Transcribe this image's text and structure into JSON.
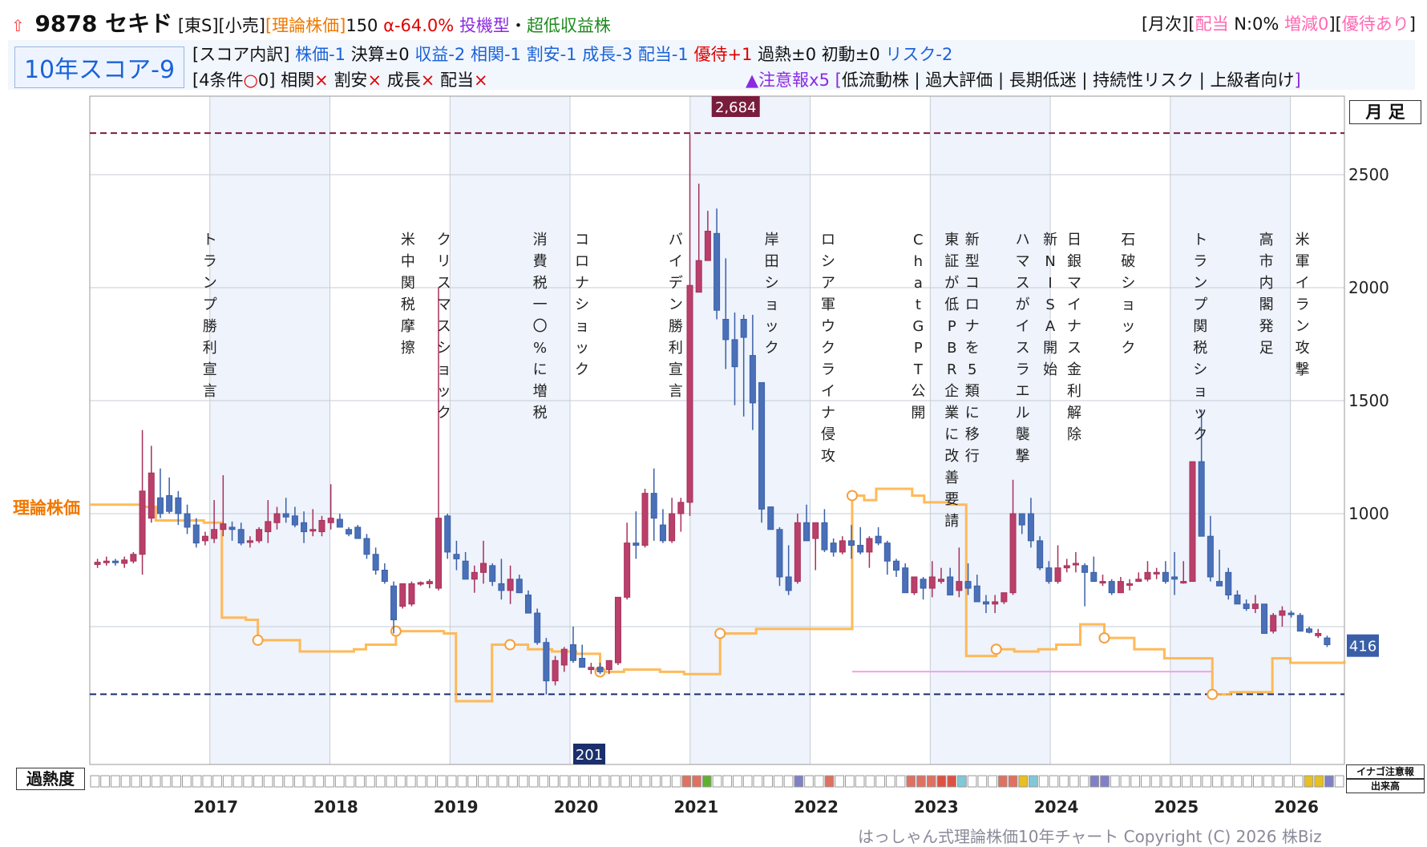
{
  "header": {
    "code_name": "9878 セキド",
    "market": "[東S][小売]",
    "theory_label": "[理論株価]",
    "theory_value": "150",
    "alpha": "α-64.0%",
    "type1": "投機型",
    "sep": "・",
    "type2": "超低収益株",
    "monthly": "[月次][",
    "dividend": "配当",
    "n_text": " N:0% ",
    "change": "増減0",
    "close_br": "][",
    "yutai": "優待あり",
    "end_br": "]"
  },
  "score": {
    "box": "10年スコア-9",
    "line1_prefix": "[スコア内訳]",
    "line1_items": [
      {
        "text": "株価-1",
        "color": "#1a63d8"
      },
      {
        "text": "決算±0",
        "color": "#111111"
      },
      {
        "text": "収益-2",
        "color": "#1a63d8"
      },
      {
        "text": "相関-1",
        "color": "#1a63d8"
      },
      {
        "text": "割安-1",
        "color": "#1a63d8"
      },
      {
        "text": "成長-3",
        "color": "#1a63d8"
      },
      {
        "text": "配当-1",
        "color": "#1a63d8"
      },
      {
        "text": "優待+1",
        "color": "#e00000"
      },
      {
        "text": "過熱±0",
        "color": "#111111"
      },
      {
        "text": "初動±0",
        "color": "#111111"
      },
      {
        "text": "リスク-2",
        "color": "#1a63d8"
      }
    ],
    "line2_prefix": "[4条件",
    "line2_circle": "○",
    "line2_zero": "0]",
    "line2_items": [
      "相関",
      "割安",
      "成長",
      "配当"
    ],
    "cross": "×",
    "warning_label": "▲注意報x5",
    "warning_open": "[",
    "warning_list": "低流動株 | 過大評価 | 長期低迷 | 持続性リスク | 上級者向け",
    "warning_close": "]"
  },
  "chart_data": {
    "type": "candlestick",
    "period": "月足",
    "y_ticks": [
      1000,
      1500,
      2000,
      2500
    ],
    "ylim": [
      201,
      2684
    ],
    "high_label": "2,684",
    "low_label": "201",
    "last_price_label": "416",
    "theory_line_label": "理論株価",
    "years": [
      "2017",
      "2018",
      "2019",
      "2020",
      "2021",
      "2022",
      "2023",
      "2024",
      "2025",
      "2026"
    ],
    "events": [
      {
        "x": 2017.0,
        "text": "トランプ勝利宣言"
      },
      {
        "x": 2018.65,
        "text": "米中関税摩擦"
      },
      {
        "x": 2018.95,
        "text": "クリスマスショック"
      },
      {
        "x": 2019.75,
        "text": "消費税一〇%に増税"
      },
      {
        "x": 2020.1,
        "text": "コロナショック"
      },
      {
        "x": 2020.88,
        "text": "バイデン勝利宣言"
      },
      {
        "x": 2021.68,
        "text": "岸田ショック"
      },
      {
        "x": 2022.15,
        "text": "ロシア軍ウクライナ侵攻"
      },
      {
        "x": 2022.9,
        "text": "ChatGPT公開"
      },
      {
        "x": 2023.18,
        "text": "東証が低PBR企業に改善要請"
      },
      {
        "x": 2023.35,
        "text": "新型コロナを5類に移行"
      },
      {
        "x": 2023.77,
        "text": "ハマスがイスラエル襲撃"
      },
      {
        "x": 2024.0,
        "text": "新NISA開始"
      },
      {
        "x": 2024.2,
        "text": "日銀マイナス金利解除"
      },
      {
        "x": 2024.65,
        "text": "石破ショック"
      },
      {
        "x": 2025.25,
        "text": "トランプ関税ショック"
      },
      {
        "x": 2025.8,
        "text": "高市内閣発足"
      },
      {
        "x": 2026.1,
        "text": "米軍イラン攻撃"
      }
    ],
    "candles": [
      {
        "o": 775,
        "h": 800,
        "l": 760,
        "c": 785
      },
      {
        "o": 785,
        "h": 810,
        "l": 770,
        "c": 790
      },
      {
        "o": 790,
        "h": 800,
        "l": 770,
        "c": 785
      },
      {
        "o": 780,
        "h": 810,
        "l": 760,
        "c": 795
      },
      {
        "o": 790,
        "h": 830,
        "l": 780,
        "c": 820
      },
      {
        "o": 820,
        "h": 1370,
        "l": 730,
        "c": 1100
      },
      {
        "o": 980,
        "h": 1300,
        "l": 960,
        "c": 1180
      },
      {
        "o": 1070,
        "h": 1200,
        "l": 980,
        "c": 1000
      },
      {
        "o": 1080,
        "h": 1160,
        "l": 1000,
        "c": 1010
      },
      {
        "o": 1070,
        "h": 1100,
        "l": 950,
        "c": 1000
      },
      {
        "o": 1000,
        "h": 1040,
        "l": 910,
        "c": 940
      },
      {
        "o": 950,
        "h": 980,
        "l": 850,
        "c": 870
      },
      {
        "o": 880,
        "h": 920,
        "l": 860,
        "c": 900
      },
      {
        "o": 890,
        "h": 1060,
        "l": 870,
        "c": 930
      },
      {
        "o": 930,
        "h": 1170,
        "l": 900,
        "c": 955
      },
      {
        "o": 940,
        "h": 965,
        "l": 880,
        "c": 930
      },
      {
        "o": 930,
        "h": 960,
        "l": 860,
        "c": 870
      },
      {
        "o": 880,
        "h": 900,
        "l": 850,
        "c": 880
      },
      {
        "o": 880,
        "h": 940,
        "l": 870,
        "c": 930
      },
      {
        "o": 920,
        "h": 1060,
        "l": 870,
        "c": 965
      },
      {
        "o": 960,
        "h": 1030,
        "l": 930,
        "c": 1000
      },
      {
        "o": 1000,
        "h": 1070,
        "l": 960,
        "c": 985
      },
      {
        "o": 990,
        "h": 1030,
        "l": 940,
        "c": 950
      },
      {
        "o": 960,
        "h": 1010,
        "l": 870,
        "c": 920
      },
      {
        "o": 930,
        "h": 1020,
        "l": 900,
        "c": 930
      },
      {
        "o": 920,
        "h": 990,
        "l": 900,
        "c": 970
      },
      {
        "o": 960,
        "h": 1130,
        "l": 930,
        "c": 980
      },
      {
        "o": 975,
        "h": 1000,
        "l": 940,
        "c": 940
      },
      {
        "o": 930,
        "h": 940,
        "l": 900,
        "c": 910
      },
      {
        "o": 940,
        "h": 950,
        "l": 890,
        "c": 890
      },
      {
        "o": 890,
        "h": 910,
        "l": 800,
        "c": 820
      },
      {
        "o": 820,
        "h": 850,
        "l": 730,
        "c": 750
      },
      {
        "o": 750,
        "h": 780,
        "l": 690,
        "c": 700
      },
      {
        "o": 680,
        "h": 700,
        "l": 470,
        "c": 530
      },
      {
        "o": 590,
        "h": 690,
        "l": 580,
        "c": 690
      },
      {
        "o": 600,
        "h": 700,
        "l": 590,
        "c": 690
      },
      {
        "o": 690,
        "h": 700,
        "l": 680,
        "c": 695
      },
      {
        "o": 690,
        "h": 710,
        "l": 670,
        "c": 700
      },
      {
        "o": 670,
        "h": 2000,
        "l": 660,
        "c": 980
      },
      {
        "o": 990,
        "h": 1000,
        "l": 800,
        "c": 830
      },
      {
        "o": 820,
        "h": 880,
        "l": 750,
        "c": 800
      },
      {
        "o": 790,
        "h": 830,
        "l": 730,
        "c": 710
      },
      {
        "o": 710,
        "h": 770,
        "l": 650,
        "c": 740
      },
      {
        "o": 740,
        "h": 880,
        "l": 690,
        "c": 780
      },
      {
        "o": 770,
        "h": 780,
        "l": 680,
        "c": 700
      },
      {
        "o": 690,
        "h": 800,
        "l": 620,
        "c": 660
      },
      {
        "o": 660,
        "h": 770,
        "l": 600,
        "c": 710
      },
      {
        "o": 710,
        "h": 730,
        "l": 650,
        "c": 650
      },
      {
        "o": 640,
        "h": 660,
        "l": 590,
        "c": 560
      },
      {
        "o": 560,
        "h": 580,
        "l": 420,
        "c": 430
      },
      {
        "o": 430,
        "h": 450,
        "l": 200,
        "c": 260
      },
      {
        "o": 260,
        "h": 370,
        "l": 240,
        "c": 350
      },
      {
        "o": 330,
        "h": 410,
        "l": 300,
        "c": 400
      },
      {
        "o": 420,
        "h": 500,
        "l": 340,
        "c": 350
      },
      {
        "o": 360,
        "h": 420,
        "l": 320,
        "c": 320
      },
      {
        "o": 310,
        "h": 340,
        "l": 290,
        "c": 320
      },
      {
        "o": 320,
        "h": 340,
        "l": 290,
        "c": 300
      },
      {
        "o": 310,
        "h": 350,
        "l": 290,
        "c": 350
      },
      {
        "o": 340,
        "h": 600,
        "l": 330,
        "c": 630
      },
      {
        "o": 630,
        "h": 960,
        "l": 620,
        "c": 870
      },
      {
        "o": 870,
        "h": 1010,
        "l": 800,
        "c": 860
      },
      {
        "o": 860,
        "h": 1110,
        "l": 850,
        "c": 1090
      },
      {
        "o": 1090,
        "h": 1200,
        "l": 880,
        "c": 980
      },
      {
        "o": 950,
        "h": 1020,
        "l": 870,
        "c": 880
      },
      {
        "o": 880,
        "h": 1070,
        "l": 870,
        "c": 1000
      },
      {
        "o": 1000,
        "h": 1070,
        "l": 920,
        "c": 1050
      },
      {
        "o": 1050,
        "h": 2680,
        "l": 990,
        "c": 2010
      },
      {
        "o": 1980,
        "h": 2460,
        "l": 1980,
        "c": 2120
      },
      {
        "o": 2120,
        "h": 2340,
        "l": 2130,
        "c": 2250
      },
      {
        "o": 2240,
        "h": 2350,
        "l": 1860,
        "c": 1900
      },
      {
        "o": 1860,
        "h": 2130,
        "l": 1640,
        "c": 1770
      },
      {
        "o": 1770,
        "h": 1890,
        "l": 1480,
        "c": 1650
      },
      {
        "o": 1860,
        "h": 1880,
        "l": 1430,
        "c": 1780
      },
      {
        "o": 1700,
        "h": 1880,
        "l": 1370,
        "c": 1490
      },
      {
        "o": 1580,
        "h": 1580,
        "l": 960,
        "c": 1020
      },
      {
        "o": 1030,
        "h": 1030,
        "l": 940,
        "c": 930
      },
      {
        "o": 930,
        "h": 940,
        "l": 680,
        "c": 720
      },
      {
        "o": 720,
        "h": 860,
        "l": 640,
        "c": 660
      },
      {
        "o": 700,
        "h": 1000,
        "l": 690,
        "c": 960
      },
      {
        "o": 960,
        "h": 1040,
        "l": 880,
        "c": 880
      },
      {
        "o": 890,
        "h": 960,
        "l": 750,
        "c": 960
      },
      {
        "o": 960,
        "h": 1020,
        "l": 830,
        "c": 840
      },
      {
        "o": 870,
        "h": 890,
        "l": 810,
        "c": 830
      },
      {
        "o": 830,
        "h": 900,
        "l": 820,
        "c": 880
      },
      {
        "o": 880,
        "h": 950,
        "l": 800,
        "c": 860
      },
      {
        "o": 860,
        "h": 940,
        "l": 820,
        "c": 830
      },
      {
        "o": 830,
        "h": 900,
        "l": 760,
        "c": 890
      },
      {
        "o": 900,
        "h": 940,
        "l": 860,
        "c": 870
      },
      {
        "o": 870,
        "h": 880,
        "l": 730,
        "c": 790
      },
      {
        "o": 790,
        "h": 800,
        "l": 720,
        "c": 750
      },
      {
        "o": 760,
        "h": 780,
        "l": 650,
        "c": 650
      },
      {
        "o": 650,
        "h": 720,
        "l": 640,
        "c": 720
      },
      {
        "o": 710,
        "h": 720,
        "l": 620,
        "c": 670
      },
      {
        "o": 670,
        "h": 790,
        "l": 630,
        "c": 720
      },
      {
        "o": 700,
        "h": 760,
        "l": 690,
        "c": 710
      },
      {
        "o": 720,
        "h": 760,
        "l": 650,
        "c": 640
      },
      {
        "o": 660,
        "h": 850,
        "l": 630,
        "c": 700
      },
      {
        "o": 700,
        "h": 780,
        "l": 640,
        "c": 670
      },
      {
        "o": 680,
        "h": 730,
        "l": 610,
        "c": 610
      },
      {
        "o": 610,
        "h": 640,
        "l": 560,
        "c": 600
      },
      {
        "o": 600,
        "h": 640,
        "l": 560,
        "c": 610
      },
      {
        "o": 610,
        "h": 650,
        "l": 600,
        "c": 650
      },
      {
        "o": 650,
        "h": 1150,
        "l": 640,
        "c": 1000
      },
      {
        "o": 1000,
        "h": 1000,
        "l": 910,
        "c": 950
      },
      {
        "o": 1000,
        "h": 1070,
        "l": 850,
        "c": 880
      },
      {
        "o": 880,
        "h": 900,
        "l": 750,
        "c": 760
      },
      {
        "o": 760,
        "h": 790,
        "l": 690,
        "c": 700
      },
      {
        "o": 700,
        "h": 860,
        "l": 690,
        "c": 760
      },
      {
        "o": 760,
        "h": 800,
        "l": 740,
        "c": 770
      },
      {
        "o": 780,
        "h": 830,
        "l": 740,
        "c": 780
      },
      {
        "o": 770,
        "h": 780,
        "l": 590,
        "c": 740
      },
      {
        "o": 740,
        "h": 810,
        "l": 700,
        "c": 700
      },
      {
        "o": 700,
        "h": 730,
        "l": 680,
        "c": 700
      },
      {
        "o": 700,
        "h": 710,
        "l": 640,
        "c": 650
      },
      {
        "o": 650,
        "h": 720,
        "l": 650,
        "c": 700
      },
      {
        "o": 690,
        "h": 710,
        "l": 660,
        "c": 690
      },
      {
        "o": 700,
        "h": 740,
        "l": 700,
        "c": 710
      },
      {
        "o": 710,
        "h": 790,
        "l": 700,
        "c": 740
      },
      {
        "o": 740,
        "h": 760,
        "l": 710,
        "c": 740
      },
      {
        "o": 740,
        "h": 790,
        "l": 690,
        "c": 700
      },
      {
        "o": 720,
        "h": 830,
        "l": 640,
        "c": 710
      },
      {
        "o": 700,
        "h": 790,
        "l": 690,
        "c": 700
      },
      {
        "o": 700,
        "h": 1210,
        "l": 700,
        "c": 1230
      },
      {
        "o": 1230,
        "h": 1460,
        "l": 920,
        "c": 900
      },
      {
        "o": 900,
        "h": 990,
        "l": 700,
        "c": 720
      },
      {
        "o": 700,
        "h": 840,
        "l": 690,
        "c": 680
      },
      {
        "o": 740,
        "h": 760,
        "l": 620,
        "c": 640
      },
      {
        "o": 640,
        "h": 660,
        "l": 600,
        "c": 600
      },
      {
        "o": 600,
        "h": 620,
        "l": 570,
        "c": 580
      },
      {
        "o": 580,
        "h": 640,
        "l": 560,
        "c": 600
      },
      {
        "o": 600,
        "h": 580,
        "l": 470,
        "c": 470
      },
      {
        "o": 480,
        "h": 560,
        "l": 470,
        "c": 550
      },
      {
        "o": 550,
        "h": 590,
        "l": 500,
        "c": 570
      },
      {
        "o": 560,
        "h": 570,
        "l": 540,
        "c": 555
      },
      {
        "o": 550,
        "h": 560,
        "l": 480,
        "c": 480
      },
      {
        "o": 490,
        "h": 500,
        "l": 470,
        "c": 475
      },
      {
        "o": 460,
        "h": 490,
        "l": 450,
        "c": 470
      },
      {
        "o": 450,
        "h": 460,
        "l": 410,
        "c": 420
      }
    ],
    "theory_points": [
      [
        2016.0,
        1040
      ],
      [
        2016.45,
        1030
      ],
      [
        2016.55,
        970
      ],
      [
        2016.95,
        960
      ],
      [
        2017.1,
        540
      ],
      [
        2017.3,
        530
      ],
      [
        2017.4,
        440
      ],
      [
        2017.65,
        440
      ],
      [
        2017.75,
        390
      ],
      [
        2018.2,
        400
      ],
      [
        2018.3,
        420
      ],
      [
        2018.55,
        480
      ],
      [
        2018.85,
        480
      ],
      [
        2018.95,
        470
      ],
      [
        2019.05,
        170
      ],
      [
        2019.2,
        170
      ],
      [
        2019.35,
        420
      ],
      [
        2019.5,
        420
      ],
      [
        2019.65,
        400
      ],
      [
        2019.85,
        390
      ],
      [
        2020.05,
        380
      ],
      [
        2020.25,
        300
      ],
      [
        2020.45,
        310
      ],
      [
        2020.75,
        300
      ],
      [
        2020.95,
        290
      ],
      [
        2021.1,
        290
      ],
      [
        2021.25,
        470
      ],
      [
        2021.45,
        470
      ],
      [
        2021.55,
        490
      ],
      [
        2021.7,
        490
      ],
      [
        2021.95,
        490
      ],
      [
        2022.2,
        490
      ],
      [
        2022.35,
        1080
      ],
      [
        2022.45,
        1060
      ],
      [
        2022.55,
        1110
      ],
      [
        2022.85,
        1080
      ],
      [
        2022.95,
        1050
      ],
      [
        2023.15,
        1040
      ],
      [
        2023.3,
        370
      ],
      [
        2023.55,
        400
      ],
      [
        2023.7,
        390
      ],
      [
        2023.9,
        400
      ],
      [
        2024.05,
        420
      ],
      [
        2024.25,
        510
      ],
      [
        2024.45,
        450
      ],
      [
        2024.7,
        400
      ],
      [
        2024.95,
        360
      ],
      [
        2025.2,
        360
      ],
      [
        2025.35,
        200
      ],
      [
        2025.5,
        210
      ],
      [
        2025.7,
        210
      ],
      [
        2025.85,
        360
      ],
      [
        2026.0,
        340
      ],
      [
        2026.45,
        350
      ]
    ]
  },
  "labels": {
    "period_button": "月 足",
    "overheat": "過熱度",
    "inago": "イナゴ注意報",
    "volume": "出来高",
    "copyright": "はっしゃん式理論株価10年チャート Copyright (C) 2026 株Biz"
  }
}
